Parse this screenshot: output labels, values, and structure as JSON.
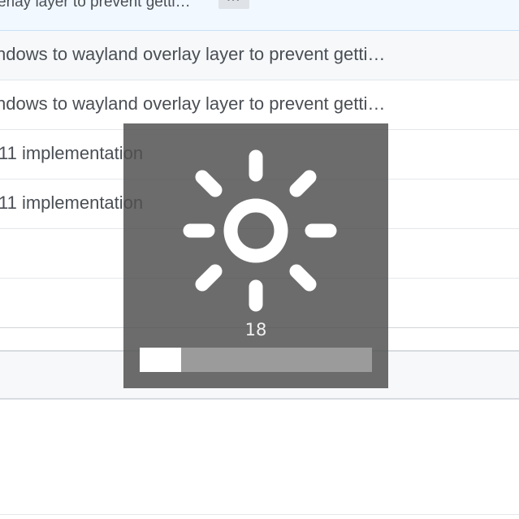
{
  "commits": {
    "rows": [
      {
        "title": "erlay layer to prevent getti…",
        "more_label": "···"
      },
      {
        "title": "ndows to wayland overlay layer to prevent getti…"
      },
      {
        "title": "ndows to wayland overlay layer to prevent getti…"
      },
      {
        "title": "11 implementation"
      },
      {
        "title": "11 implementation"
      }
    ]
  },
  "osd": {
    "icon": "brightness-sun-icon",
    "value_label": "18",
    "level": 0.18
  }
}
